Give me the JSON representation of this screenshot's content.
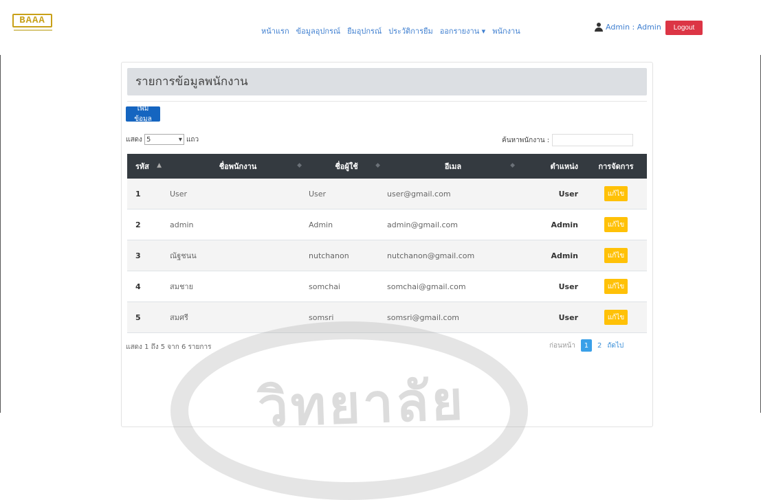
{
  "nav": {
    "logo_text": "BAAA",
    "menu": [
      "หน้าแรก",
      "ข้อมูลอุปกรณ์",
      "ยืมอุปกรณ์",
      "ประวัติการยืม",
      "ออกรายงาน ▾",
      "พนักงาน"
    ],
    "user_label": "Admin : Admin",
    "logout_label": "Logout"
  },
  "page": {
    "title": "รายการข้อมูลพนักงาน",
    "add_label": "เพิ่มข้อมูล",
    "show_prefix": "แสดง",
    "show_value": "5",
    "show_suffix": "แถว",
    "search_label": "ค้นหาพนักงาน :"
  },
  "table": {
    "headers": [
      "รหัส",
      "ชื่อพนักงาน",
      "ชื่อผู้ใช้",
      "อีเมล",
      "ตำแหน่ง",
      "การจัดการ"
    ],
    "rows": [
      {
        "id": "1",
        "name": "User",
        "username": "User",
        "email": "user@gmail.com",
        "role": "User",
        "action": "แก้ไข"
      },
      {
        "id": "2",
        "name": "admin",
        "username": "Admin",
        "email": "admin@gmail.com",
        "role": "Admin",
        "action": "แก้ไข"
      },
      {
        "id": "3",
        "name": "ณัฐชนน",
        "username": "nutchanon",
        "email": "nutchanon@gmail.com",
        "role": "Admin",
        "action": "แก้ไข"
      },
      {
        "id": "4",
        "name": "สมชาย",
        "username": "somchai",
        "email": "somchai@gmail.com",
        "role": "User",
        "action": "แก้ไข"
      },
      {
        "id": "5",
        "name": "สมศรี",
        "username": "somsri",
        "email": "somsri@gmail.com",
        "role": "User",
        "action": "แก้ไข"
      }
    ]
  },
  "footer": {
    "info": "แสดง 1 ถึง 5 จาก 6 รายการ",
    "prev": "ก่อนหน้า",
    "pages": [
      "1",
      "2"
    ],
    "next": "ถัดไป"
  },
  "colors": {
    "navbar_link": "#3f7fd0",
    "logout": "#dc3545",
    "add_button": "#1565c0",
    "edit_button": "#ffc107",
    "table_header": "#343a40",
    "active_page": "#3aa0e8"
  }
}
